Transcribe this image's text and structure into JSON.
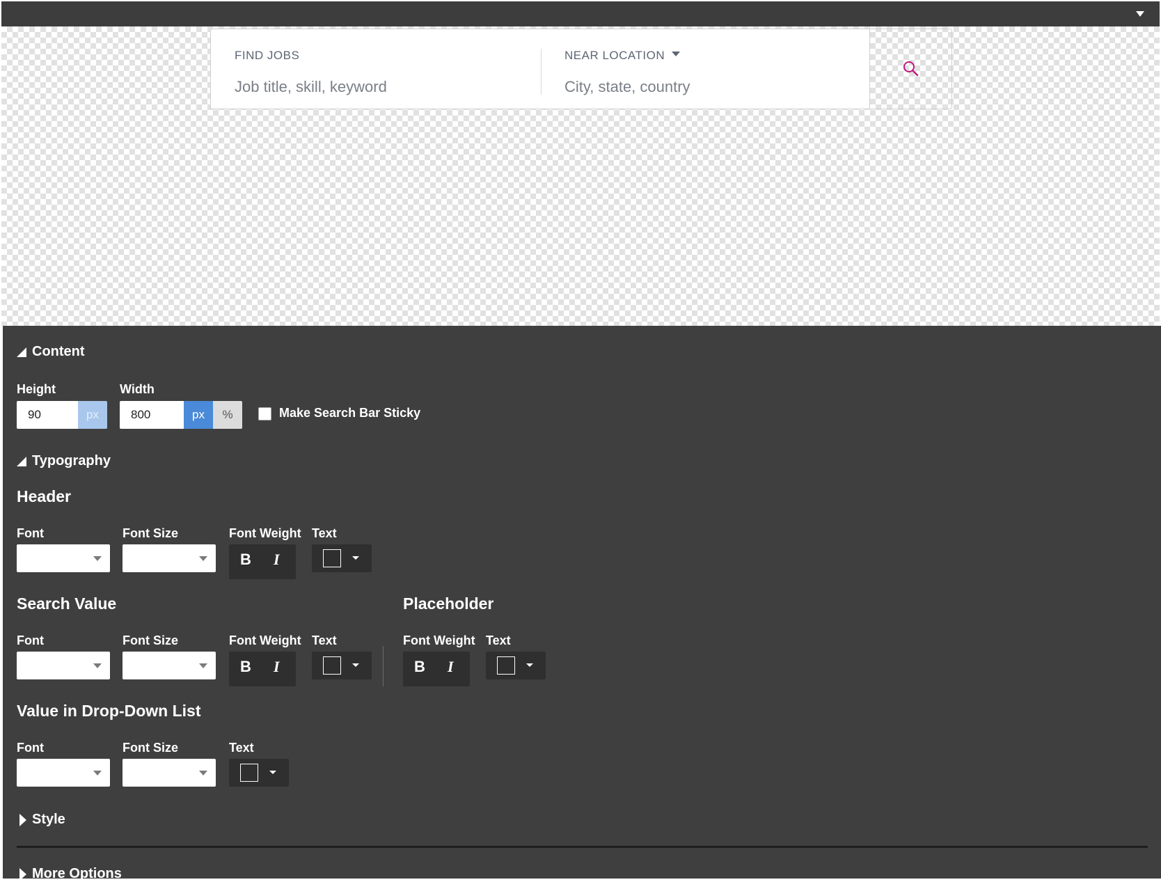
{
  "search_bar": {
    "find_label": "FIND JOBS",
    "find_placeholder": "Job title, skill, keyword",
    "location_label": "NEAR LOCATION",
    "location_placeholder": "City, state, country",
    "search_icon": "search-icon",
    "accent_color": "#c2187f"
  },
  "content": {
    "title": "Content",
    "height_label": "Height",
    "height_value": "90",
    "height_unit": "px",
    "width_label": "Width",
    "width_value": "800",
    "width_unit_px": "px",
    "width_unit_pct": "%",
    "sticky_label": "Make Search Bar Sticky",
    "sticky_checked": false
  },
  "typography": {
    "title": "Typography",
    "header": {
      "title": "Header",
      "font_label": "Font",
      "font_size_label": "Font Size",
      "font_weight_label": "Font Weight",
      "text_label": "Text"
    },
    "search_value": {
      "title": "Search Value",
      "font_label": "Font",
      "font_size_label": "Font Size",
      "font_weight_label": "Font Weight",
      "text_label": "Text"
    },
    "placeholder": {
      "title": "Placeholder",
      "font_weight_label": "Font Weight",
      "text_label": "Text"
    },
    "dropdown_value": {
      "title": "Value in Drop-Down List",
      "font_label": "Font",
      "font_size_label": "Font Size",
      "text_label": "Text"
    },
    "bold_glyph": "B",
    "italic_glyph": "I"
  },
  "style": {
    "title": "Style"
  },
  "more_options": {
    "title": "More Options"
  },
  "colors": {
    "panel_bg": "#3f3f3f",
    "px_active": "#4a8ad8",
    "px_disabled": "#a9c7ec"
  }
}
